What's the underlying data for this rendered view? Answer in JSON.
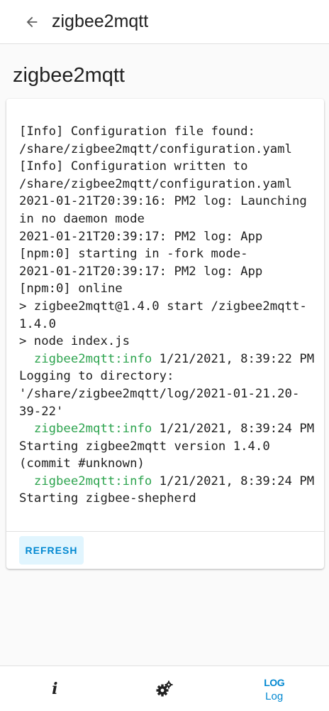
{
  "header": {
    "title": "zigbee2mqtt",
    "back_icon": "arrow-back-icon"
  },
  "page": {
    "title": "zigbee2mqtt"
  },
  "log": {
    "lines": [
      {
        "text": "[Info] Configuration file found: /share/zigbee2mqtt/configuration.yaml"
      },
      {
        "text": "[Info] Configuration written to /share/zigbee2mqtt/configuration.yaml"
      },
      {
        "text": "2021-01-21T20:39:16: PM2 log: Launching in no daemon mode"
      },
      {
        "text": "2021-01-21T20:39:17: PM2 log: App [npm:0] starting in -fork mode-"
      },
      {
        "text": "2021-01-21T20:39:17: PM2 log: App [npm:0] online"
      },
      {
        "text": "> zigbee2mqtt@1.4.0 start /zigbee2mqtt-1.4.0"
      },
      {
        "text": "> node index.js"
      },
      {
        "tag": "  zigbee2mqtt:info",
        "text": " 1/21/2021, 8:39:22 PM Logging to directory: '/share/zigbee2mqtt/log/2021-01-21.20-39-22'"
      },
      {
        "tag": "  zigbee2mqtt:info",
        "text": " 1/21/2021, 8:39:24 PM Starting zigbee2mqtt version 1.4.0 (commit #unknown)"
      },
      {
        "tag": "  zigbee2mqtt:info",
        "text": " 1/21/2021, 8:39:24 PM Starting zigbee-shepherd"
      }
    ]
  },
  "actions": {
    "refresh_label": "REFRESH"
  },
  "bottom_nav": {
    "info": {
      "icon": "info-icon",
      "glyph": "i"
    },
    "config": {
      "icon": "gears-icon"
    },
    "log": {
      "icon_text": "LOG",
      "label": "Log"
    }
  },
  "colors": {
    "accent": "#0288d1",
    "accent_bg": "#e1f5fe",
    "log_tag": "#2ea44f",
    "background": "#fafafa"
  }
}
